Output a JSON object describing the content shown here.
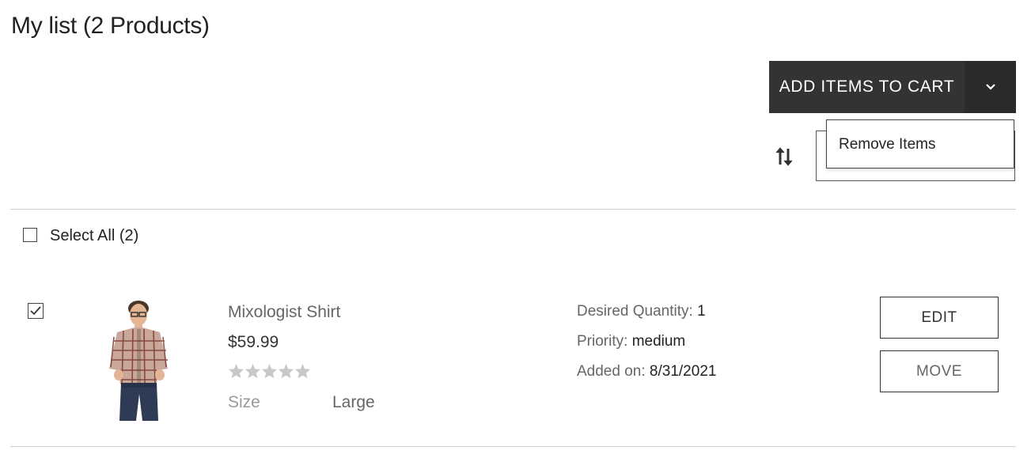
{
  "header": {
    "title": "My list (2 Products)"
  },
  "toolbar": {
    "add_to_cart_label": "ADD ITEMS TO CART",
    "dropdown_items": [
      "Remove Items"
    ]
  },
  "list": {
    "select_all_label": "Select All (2)",
    "select_all_checked": false,
    "items": [
      {
        "checked": true,
        "name": "Mixologist Shirt",
        "price": "$59.99",
        "rating_stars": 0,
        "rating_max": 5,
        "attributes": [
          {
            "label": "Size",
            "value": "Large"
          }
        ],
        "desired_quantity_label": "Desired Quantity:",
        "desired_quantity": "1",
        "priority_label": "Priority:",
        "priority": "medium",
        "added_on_label": "Added on:",
        "added_on": "8/31/2021",
        "edit_label": "EDIT",
        "move_label": "MOVE"
      }
    ]
  },
  "colors": {
    "primary_button": "#333333",
    "star_empty": "#c8c8c8",
    "divider": "#cfcfcf"
  },
  "icons": {
    "sort": "sort-arrows-icon",
    "dropdown": "chevron-down-icon",
    "check": "checkmark-icon",
    "star": "star-icon"
  }
}
